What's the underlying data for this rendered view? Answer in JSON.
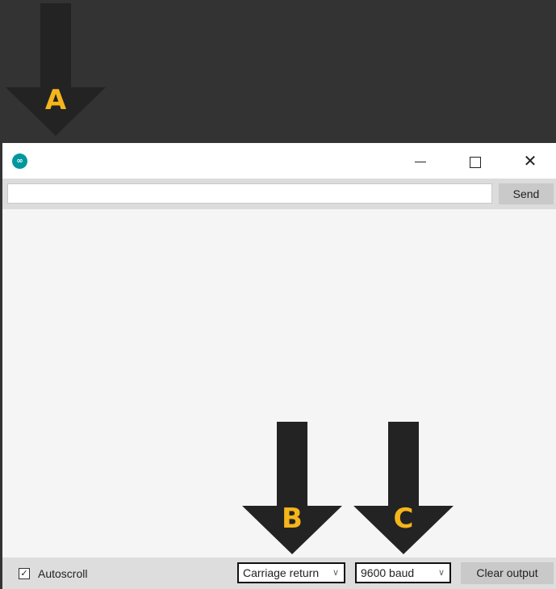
{
  "annotations": {
    "arrow_a": "A",
    "arrow_b": "B",
    "arrow_c": "C",
    "letter_color": "#f5b51b",
    "arrow_color": "#232323"
  },
  "window": {
    "app_icon": "arduino-logo-icon",
    "app_icon_glyph": "∞",
    "minimize_icon": "minimize-icon",
    "maximize_icon": "maximize-icon",
    "close_icon": "close-icon",
    "close_glyph": "✕"
  },
  "input": {
    "value": "",
    "placeholder": "",
    "send_label": "Send"
  },
  "output": {
    "text": ""
  },
  "footer": {
    "autoscroll_label": "Autoscroll",
    "autoscroll_checked": true,
    "checkbox_glyph": "✓",
    "line_ending": "Carriage return",
    "baud_rate": "9600 baud",
    "chevron_glyph": "∨",
    "clear_label": "Clear output"
  }
}
